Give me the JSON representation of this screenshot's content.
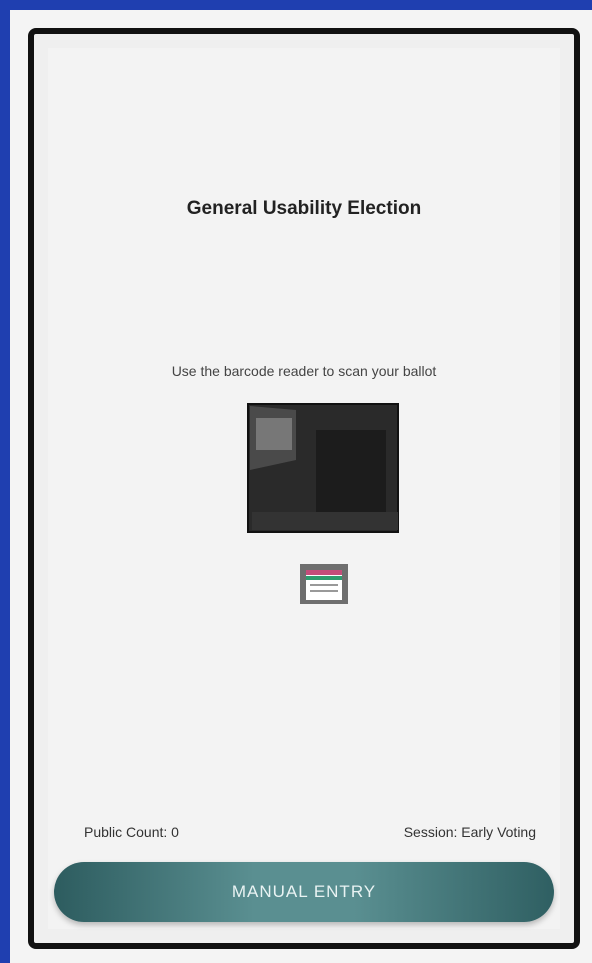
{
  "election": {
    "title": "General Usability Election",
    "instruction": "Use the barcode reader to scan your ballot"
  },
  "status": {
    "public_count": "Public Count: 0",
    "session": "Session: Early Voting"
  },
  "actions": {
    "manual_entry_label": "MANUAL ENTRY"
  },
  "icons": {
    "scanner": "ballot-scanner-icon",
    "ballot": "ballot-sheet-icon"
  },
  "colors": {
    "page_background": "#1f3fb0",
    "button_accent": "#5a8f91"
  }
}
